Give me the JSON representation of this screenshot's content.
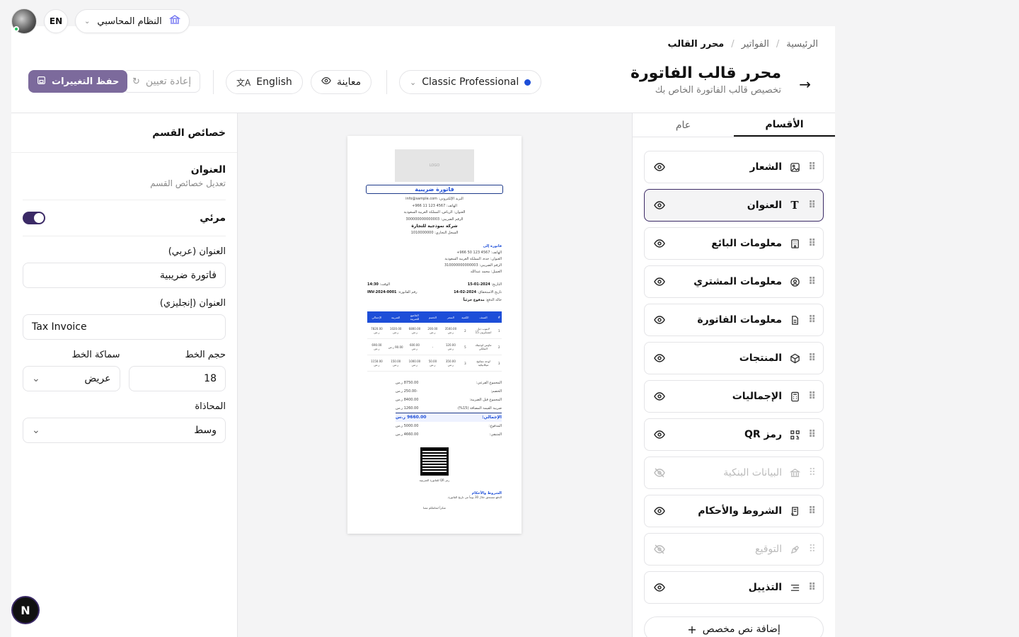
{
  "topbar": {
    "lang_code": "EN",
    "system_name": "النظام المحاسبي"
  },
  "breadcrumb": [
    "الرئيسية",
    "الفواتير",
    "محرر القالب"
  ],
  "header": {
    "title": "محرر قالب الفاتورة",
    "subtitle": "تخصيص قالب الفاتورة الخاص بك",
    "template_name": "Classic Professional",
    "preview_label": "معاينة",
    "language_label": "English",
    "reset_label": "إعادة تعيين",
    "save_label": "حفظ التغييرات",
    "accent_color": "#7c6a9c"
  },
  "props": {
    "panel_title": "خصائص القسم",
    "section_title": "العنوان",
    "section_subtitle": "تعديل خصائص القسم",
    "visible_label": "مرئي",
    "visible": true,
    "title_ar_label": "العنوان (عربي)",
    "title_ar_value": "فاتورة ضريبية",
    "title_en_label": "العنوان (إنجليزي)",
    "title_en_value": "Tax Invoice",
    "font_size_label": "حجم الخط",
    "font_size_value": "18",
    "font_weight_label": "سماكة الخط",
    "font_weight_value": "عريض",
    "align_label": "المحاذاة",
    "align_value": "وسط"
  },
  "preview": {
    "logo": "LOGO",
    "title": "فاتورة ضريبية",
    "seller_lines": [
      "البريد الإلكتروني: info@sample.com",
      "الهاتف: 4567 123 11 966+",
      "العنوان: الرياض، المملكة العربية السعودية",
      "الرقم الضريبي: 300000000000003"
    ],
    "seller_name": "شركة نموذجية للتجارة",
    "seller_cr": "السجل التجاري: 1010000000",
    "bill_to": "فاتورة إلى",
    "buyer_lines": [
      "الهاتف: 4567 123 50 966+",
      "العنوان: جدة، المملكة العربية السعودية",
      "الرقم الضريبي: 310000000000003",
      "العميل: محمد عبدالله"
    ],
    "meta": [
      {
        "k": "التاريخ:",
        "v": "2024-01-15",
        "k2": "الوقت:",
        "v2": "14:30"
      },
      {
        "k": "تاريخ الاستحقاق:",
        "v": "2024-02-14",
        "k2": "رقم الفاتورة:",
        "v2": "INV-2024-0001"
      },
      {
        "k": "حالة الدفع:",
        "v": "مدفوع جزئياً",
        "k2": "",
        "v2": ""
      }
    ],
    "table_headers": [
      "#",
      "الصنف",
      "الكمية",
      "السعر",
      "الخصم",
      "الخاضع للضريبة",
      "الضريبة",
      "الإجمالي"
    ],
    "rows": [
      [
        "1",
        "لابتوب ديل انسبايرون 15",
        "2",
        "3500.00 ر.س",
        "200.00 ر.س",
        "6800.00 ر.س",
        "1020.00 ر.س",
        "7820.00 ر.س"
      ],
      [
        "2",
        "ماوس لوجيتك لاسلكي",
        "5",
        "120.00 ر.س",
        "-",
        "600.00 ر.س",
        "90.00 ر.س",
        "690.00 ر.س"
      ],
      [
        "3",
        "لوحة مفاتيح ميكانيكية",
        "3",
        "350.00 ر.س",
        "50.00 ر.س",
        "1000.00 ر.س",
        "150.00 ر.س",
        "1150.00 ر.س"
      ]
    ],
    "totals": [
      {
        "k": "المجموع الفرعي:",
        "v": "8750.00 ر.س"
      },
      {
        "k": "الخصم:",
        "v": "-250.00 ر.س"
      },
      {
        "k": "المجموع قبل الضريبة:",
        "v": "8400.00 ر.س"
      },
      {
        "k": "ضريبة القيمة المضافة (15%):",
        "v": "1260.00 ر.س"
      }
    ],
    "grand_total_label": "الإجمالي:",
    "grand_total_value": "9660.00 ر.س",
    "paid_label": "المدفوع:",
    "paid_value": "5000.00 ر.س",
    "due_label": "المتبقي:",
    "due_value": "4660.00 ر.س",
    "qr_caption": "رمز QR للفاتورة الضريبية",
    "terms_title": "الشروط والأحكام",
    "terms_text": "الدفع مستحق خلال 30 يوماً من تاريخ الفاتورة.",
    "footer_text": "شكراً لتعاملكم معنا"
  },
  "sections": {
    "tab_general": "عام",
    "tab_sections": "الأقسام",
    "items": [
      {
        "label": "الشعار",
        "visible": true
      },
      {
        "label": "العنوان",
        "visible": true
      },
      {
        "label": "معلومات البائع",
        "visible": true
      },
      {
        "label": "معلومات المشتري",
        "visible": true
      },
      {
        "label": "معلومات الفاتورة",
        "visible": true
      },
      {
        "label": "المنتجات",
        "visible": true
      },
      {
        "label": "الإجماليات",
        "visible": true
      },
      {
        "label": "رمز QR",
        "visible": true
      },
      {
        "label": "البيانات البنكية",
        "visible": false
      },
      {
        "label": "الشروط والأحكام",
        "visible": true
      },
      {
        "label": "التوقيع",
        "visible": false
      },
      {
        "label": "التذييل",
        "visible": true
      }
    ],
    "add_label": "إضافة نص مخصص"
  },
  "badge": "N"
}
